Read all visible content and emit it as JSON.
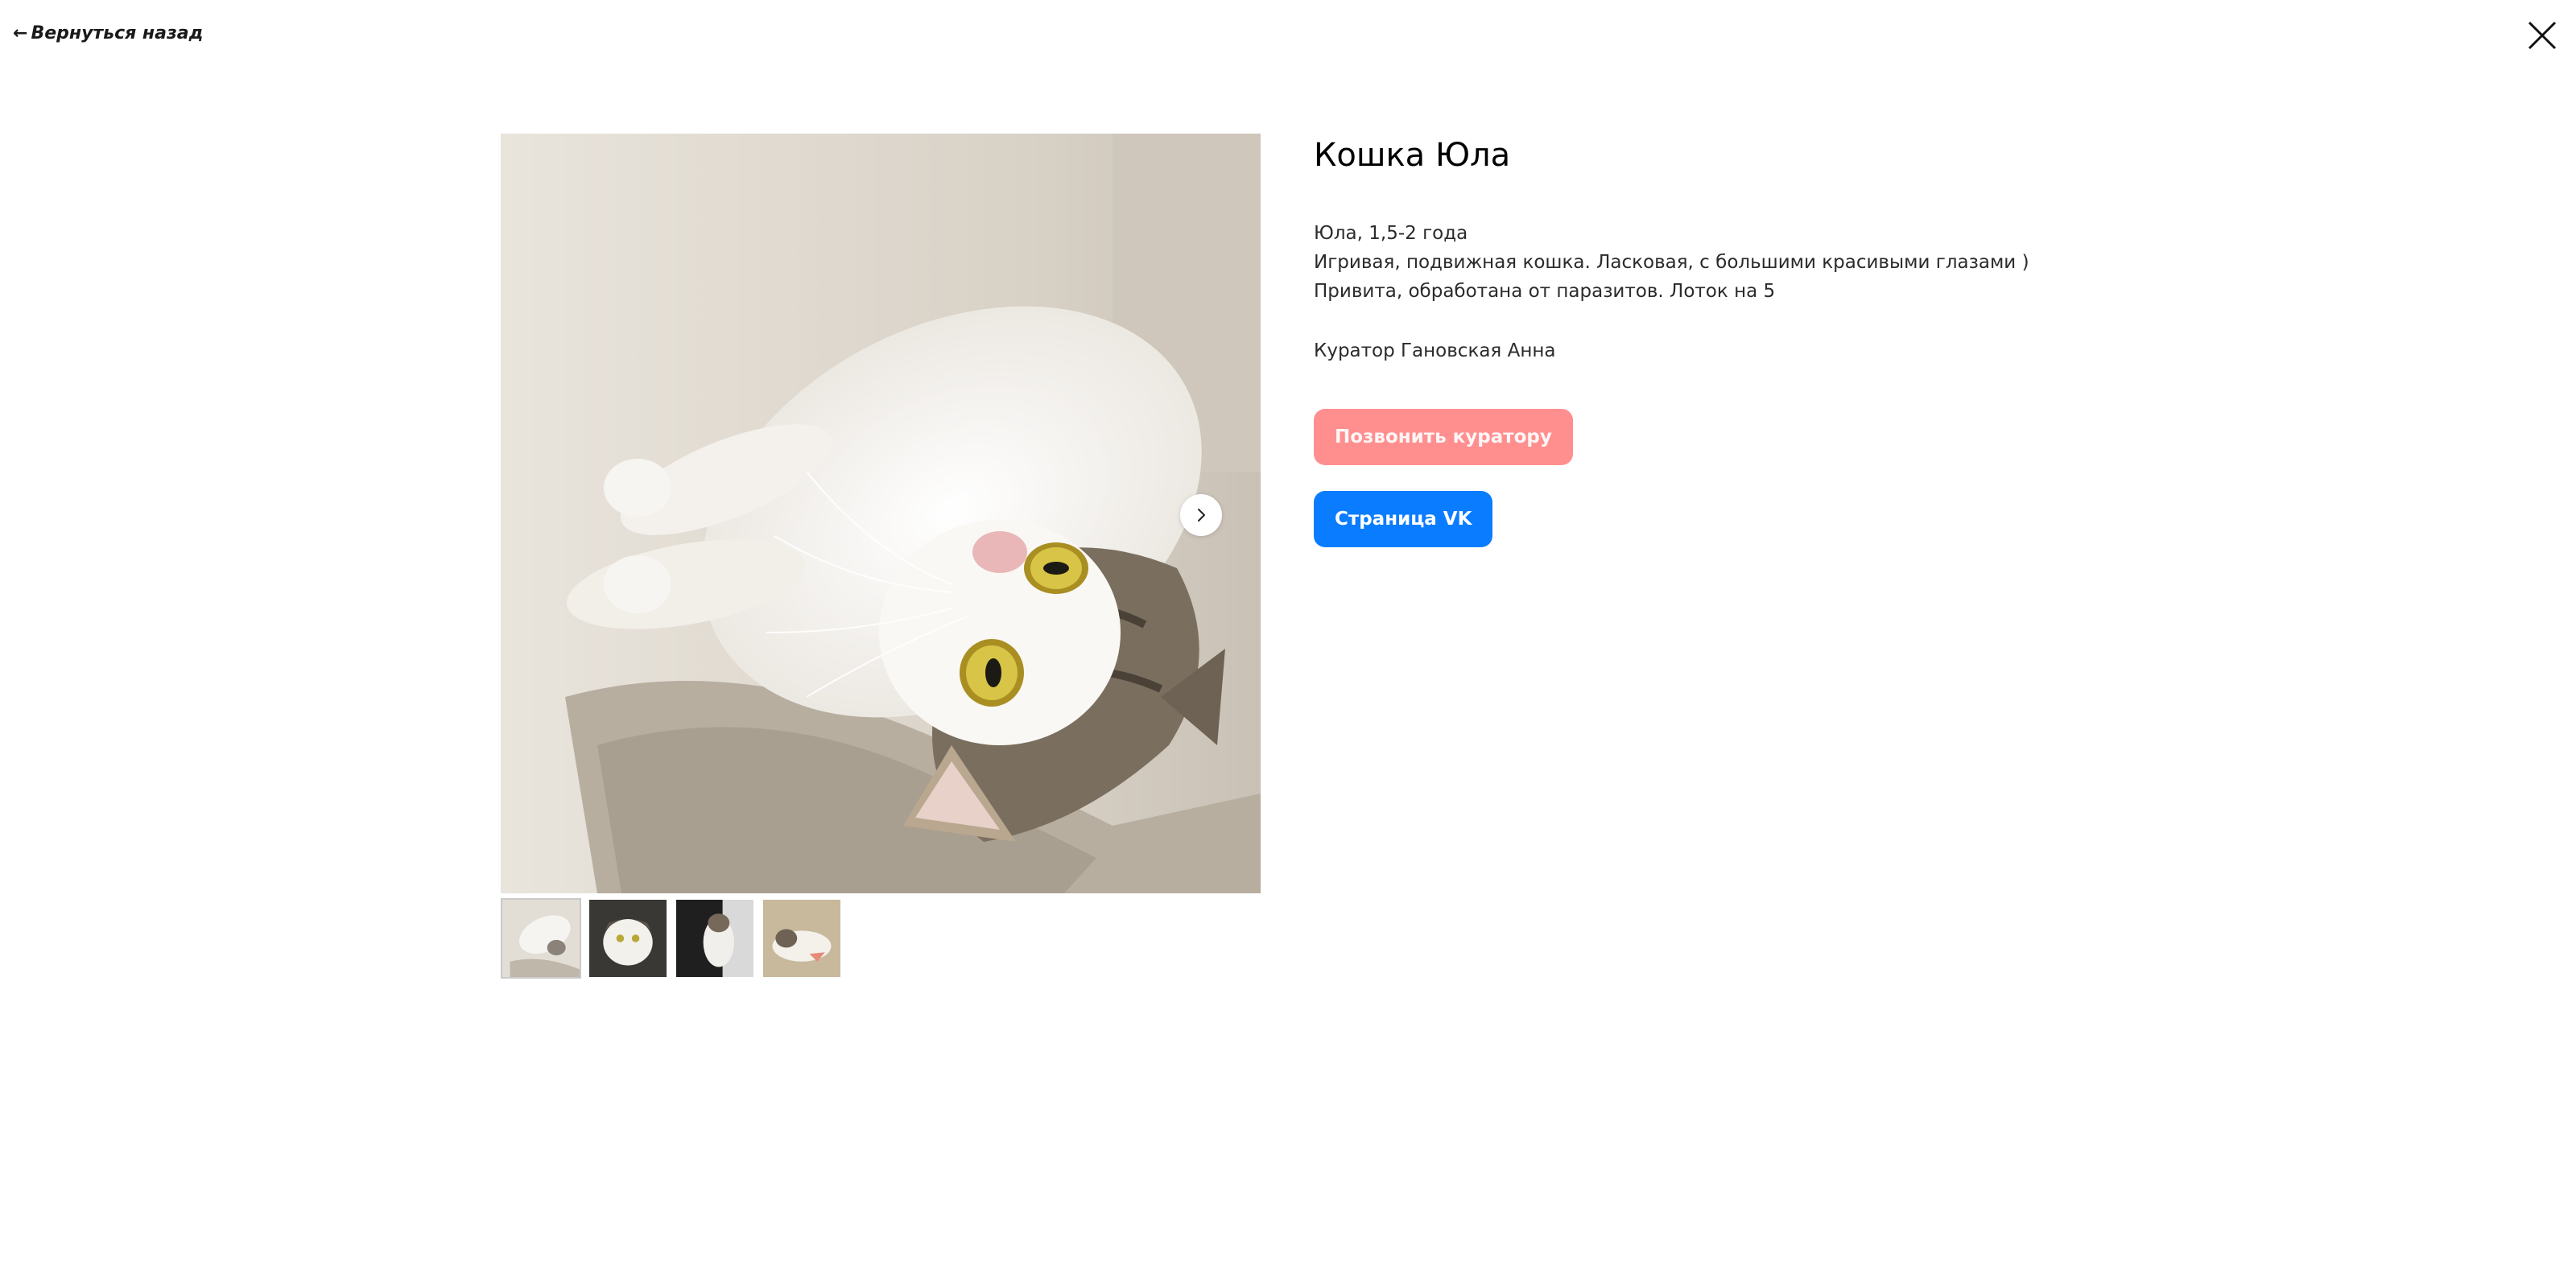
{
  "nav": {
    "back_arrow": "←",
    "back_label": "Вернуться назад"
  },
  "pet": {
    "title": "Кошка Юла",
    "description": [
      "Юла, 1,5-2 года",
      "Игривая, подвижная кошка. Ласковая, с большими красивыми глазами )",
      "Привита, обработана от паразитов. Лоток на 5"
    ],
    "curator": "Куратор Гановская Анна"
  },
  "actions": {
    "call_label": "Позвонить куратору",
    "vk_label": "Страница VK"
  },
  "gallery": {
    "thumbnail_count": 4,
    "active_index": 0,
    "next_icon": "chevron-right-icon"
  },
  "colors": {
    "call_button": "#ff8f8f",
    "vk_button": "#0a7cff"
  }
}
